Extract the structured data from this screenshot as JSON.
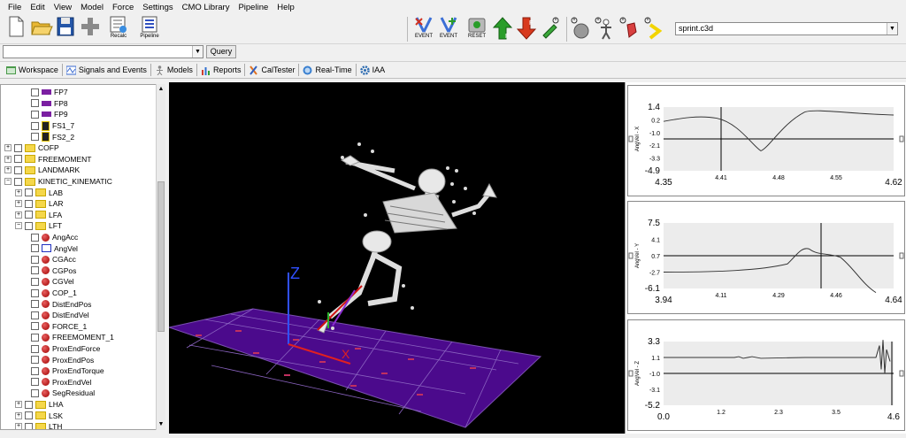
{
  "menu": [
    "File",
    "Edit",
    "View",
    "Model",
    "Force",
    "Settings",
    "CMO Library",
    "Pipeline",
    "Help"
  ],
  "toolbar": {
    "recalc_label": "Recalc",
    "pipeline_label": "Pipeline",
    "event1_label": "EVENT",
    "event2_label": "EVENT",
    "reset_label": "RESET",
    "file_select_value": "sprint.c3d"
  },
  "query": {
    "value": "",
    "button_label": "Query"
  },
  "tabs": [
    {
      "label": "Workspace"
    },
    {
      "label": "Signals and Events"
    },
    {
      "label": "Models"
    },
    {
      "label": "Reports"
    },
    {
      "label": "CalTester"
    },
    {
      "label": "Real-Time"
    },
    {
      "label": "IAA"
    }
  ],
  "tree": {
    "rows": [
      {
        "label": "FP7",
        "kind": "fp",
        "indent": 2
      },
      {
        "label": "FP8",
        "kind": "fp",
        "indent": 2
      },
      {
        "label": "FP9",
        "kind": "fp",
        "indent": 2
      },
      {
        "label": "FS1_7",
        "kind": "fs",
        "indent": 2
      },
      {
        "label": "FS2_2",
        "kind": "fs",
        "indent": 2
      },
      {
        "label": "COFP",
        "kind": "folder",
        "indent": 0
      },
      {
        "label": "FREEMOMENT",
        "kind": "folder",
        "indent": 0
      },
      {
        "label": "LANDMARK",
        "kind": "folder",
        "indent": 0
      },
      {
        "label": "KINETIC_KINEMATIC",
        "kind": "folder-open",
        "indent": 0
      },
      {
        "label": "LAB",
        "kind": "folder",
        "indent": 1
      },
      {
        "label": "LAR",
        "kind": "folder",
        "indent": 1
      },
      {
        "label": "LFA",
        "kind": "folder",
        "indent": 1
      },
      {
        "label": "LFT",
        "kind": "folder-open",
        "indent": 1
      },
      {
        "label": "AngAcc",
        "kind": "dot",
        "indent": 2
      },
      {
        "label": "AngVel",
        "kind": "wave",
        "indent": 2
      },
      {
        "label": "CGAcc",
        "kind": "dot",
        "indent": 2
      },
      {
        "label": "CGPos",
        "kind": "dot",
        "indent": 2
      },
      {
        "label": "CGVel",
        "kind": "dot",
        "indent": 2
      },
      {
        "label": "COP_1",
        "kind": "dot",
        "indent": 2
      },
      {
        "label": "DistEndPos",
        "kind": "dot",
        "indent": 2
      },
      {
        "label": "DistEndVel",
        "kind": "dot",
        "indent": 2
      },
      {
        "label": "FORCE_1",
        "kind": "dot",
        "indent": 2
      },
      {
        "label": "FREEMOMENT_1",
        "kind": "dot",
        "indent": 2
      },
      {
        "label": "ProxEndForce",
        "kind": "dot",
        "indent": 2
      },
      {
        "label": "ProxEndPos",
        "kind": "dot",
        "indent": 2
      },
      {
        "label": "ProxEndTorque",
        "kind": "dot",
        "indent": 2
      },
      {
        "label": "ProxEndVel",
        "kind": "dot",
        "indent": 2
      },
      {
        "label": "SegResidual",
        "kind": "dot",
        "indent": 2
      },
      {
        "label": "LHA",
        "kind": "folder",
        "indent": 1
      },
      {
        "label": "LSK",
        "kind": "folder",
        "indent": 1
      },
      {
        "label": "LTH",
        "kind": "folder",
        "indent": 1
      }
    ]
  },
  "viewport": {
    "axis_z_label": "Z",
    "axis_x_label": "X"
  },
  "graphs": [
    {
      "ylabel": "AngVel - X",
      "yticks": [
        "1.4",
        "0.2",
        "-1.0",
        "-2.1",
        "-3.3",
        "-4.9"
      ],
      "xticks_small": [
        "4.41",
        "4.48",
        "4.55"
      ],
      "xmin": "4.35",
      "xmax": "4.62"
    },
    {
      "ylabel": "AngVel - Y",
      "yticks": [
        "7.5",
        "4.1",
        "0.7",
        "-2.7",
        "-6.1"
      ],
      "xticks_small": [
        "4.11",
        "4.29",
        "4.46"
      ],
      "xmin": "3.94",
      "xmax": "4.64"
    },
    {
      "ylabel": "AngVel - Z",
      "yticks": [
        "3.3",
        "1.1",
        "-1.0",
        "-3.1",
        "-5.2"
      ],
      "xticks_small": [
        "1.2",
        "2.3",
        "3.5"
      ],
      "xmin": "0.0",
      "xmax": "4.6"
    }
  ]
}
